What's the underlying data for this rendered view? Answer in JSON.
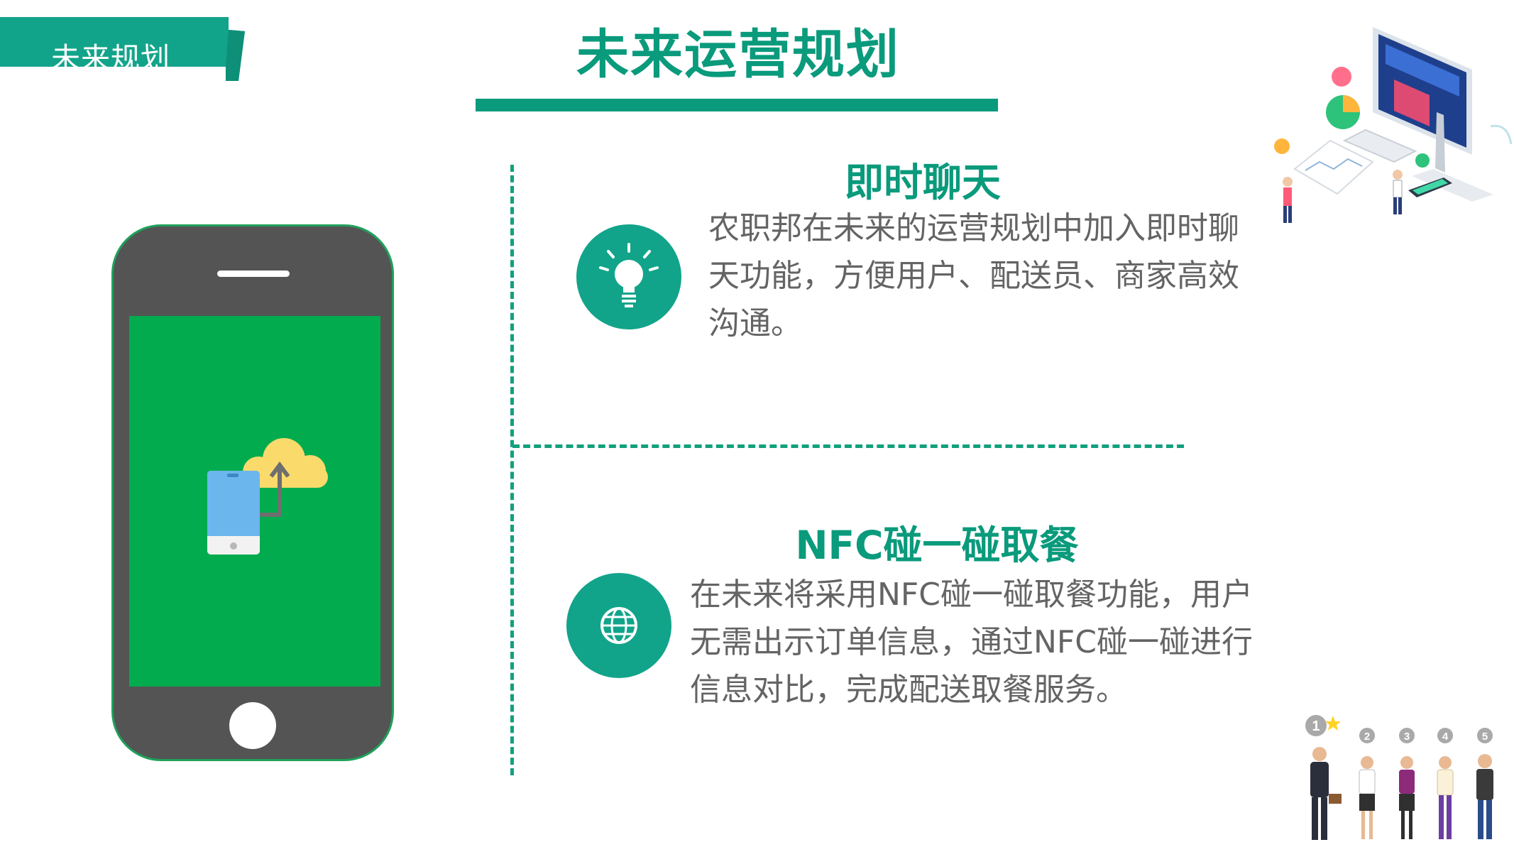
{
  "tab": {
    "label": "未来规划"
  },
  "page": {
    "title": "未来运营规划"
  },
  "features": [
    {
      "title": "即时聊天",
      "description": "农职邦在未来的运营规划中加入即时聊天功能，方便用户、配送员、商家高效沟通。",
      "icon": "lightbulb-icon"
    },
    {
      "title": "NFC碰一碰取餐",
      "description": "在未来将采用NFC碰一碰取餐功能，用户无需出示订单信息，通过NFC碰一碰进行信息对比，完成配送取餐服务。",
      "icon": "globe-icon"
    }
  ],
  "ranking": {
    "labels": [
      "1",
      "2",
      "3",
      "4",
      "5"
    ]
  },
  "colors": {
    "accent": "#0a9a7c",
    "circle": "#12a48a",
    "phone_body": "#545454",
    "phone_screen": "#02ac4e",
    "body_text": "#646464"
  }
}
